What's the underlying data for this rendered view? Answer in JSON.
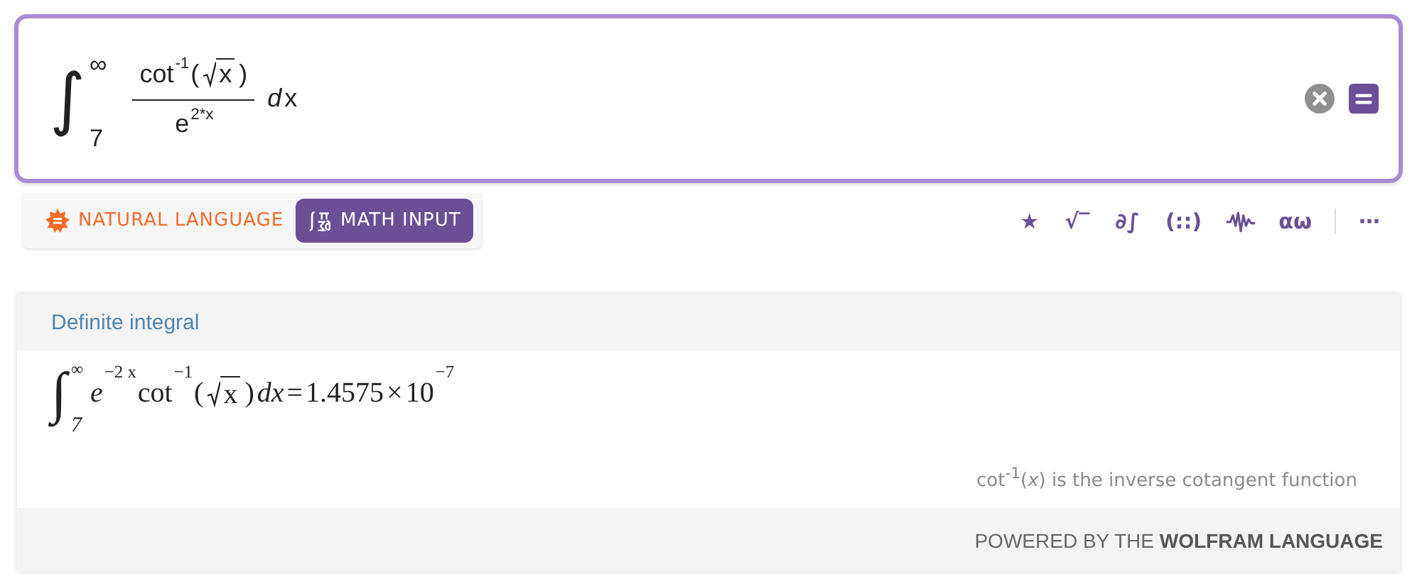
{
  "input": {
    "tokens": [
      {
        "kind": "integral",
        "sign": "∫",
        "upper": "∞",
        "lower": "7"
      },
      {
        "kind": "fraction",
        "numerator": [
          {
            "kind": "text",
            "text": "cot"
          },
          {
            "kind": "sup",
            "text": "-1"
          },
          {
            "kind": "text",
            "text": "("
          },
          {
            "kind": "sqrt",
            "text": "x"
          },
          {
            "kind": "text",
            "text": ")"
          }
        ],
        "denominator": [
          {
            "kind": "text",
            "text": "e"
          },
          {
            "kind": "sup",
            "text": "2*x"
          }
        ]
      },
      {
        "kind": "italic",
        "text": "d"
      },
      {
        "kind": "text",
        "text": "x"
      }
    ]
  },
  "modes": [
    {
      "label": "NATURAL LANGUAGE",
      "kind": "burst",
      "selected": false
    },
    {
      "label": "MATH INPUT",
      "kind": "math",
      "selected": true
    }
  ],
  "toolbar": [
    {
      "kind": "glyph",
      "label": "★"
    },
    {
      "kind": "glyph",
      "label": "√‾"
    },
    {
      "kind": "glyph",
      "label": "∂∫"
    },
    {
      "kind": "glyph",
      "label": "(::)"
    },
    {
      "kind": "wave"
    },
    {
      "kind": "glyph",
      "label": "αω"
    },
    {
      "kind": "separator"
    },
    {
      "kind": "glyph",
      "label": "⋯"
    }
  ],
  "result": {
    "title": "Definite integral",
    "tokens": [
      {
        "kind": "integral",
        "sign": "∫",
        "upper": "∞",
        "lower": "7"
      },
      {
        "kind": "italic",
        "text": "e"
      },
      {
        "kind": "sup",
        "text": "−2 x"
      },
      {
        "kind": "text",
        "text": "cot"
      },
      {
        "kind": "sup",
        "text": "−1"
      },
      {
        "kind": "text",
        "text": "("
      },
      {
        "kind": "sqrt",
        "text": "x"
      },
      {
        "kind": "text",
        "text": ")"
      },
      {
        "kind": "italic",
        "text": "dx"
      },
      {
        "kind": "text",
        "text": "="
      },
      {
        "kind": "text",
        "text": "1.4575"
      },
      {
        "kind": "text",
        "text": "×"
      },
      {
        "kind": "text",
        "text": "10"
      },
      {
        "kind": "sup",
        "text": "−7"
      }
    ],
    "note": "cot$^{-1}$(*x*) is the inverse cotangent function"
  },
  "footer": "POWERED BY THE **WOLFRAM LANGUAGE**"
}
